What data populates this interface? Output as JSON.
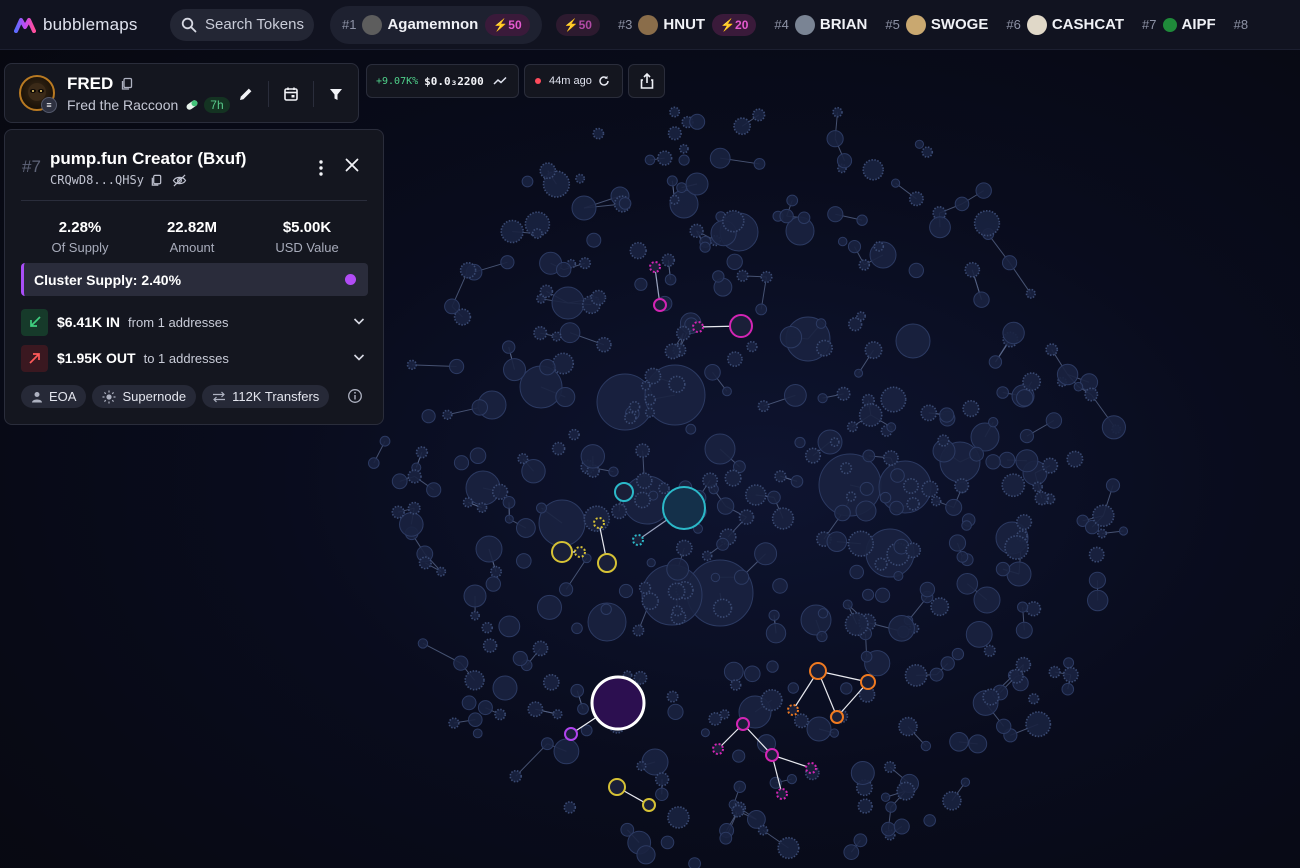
{
  "app": {
    "logo_text": "bubblemaps",
    "search_placeholder": "Search Tokens"
  },
  "ticker": [
    {
      "rank": "#1",
      "name": "Agamemnon",
      "boost": "50",
      "boost2": "50",
      "avatar": "#5d5d5d"
    },
    {
      "rank": "#3",
      "name": "HNUT",
      "boost": "20",
      "avatar": "#8a6d4a"
    },
    {
      "rank": "#4",
      "name": "BRIAN",
      "avatar": "#7a8494"
    },
    {
      "rank": "#5",
      "name": "SWOGE",
      "avatar": "#c9a870"
    },
    {
      "rank": "#6",
      "name": "CASHCAT",
      "avatar": "#e0d8c8"
    },
    {
      "rank": "#7",
      "name": "AIPF",
      "avatar": "#1f8a3a"
    },
    {
      "rank": "#8",
      "name": "",
      "avatar": ""
    }
  ],
  "token": {
    "symbol": "FRED",
    "name": "Fred the Raccoon",
    "age": "7h",
    "chain_badge": "≡"
  },
  "price": {
    "change": "+9.07K%",
    "value": "$0.0₃2200"
  },
  "refresh": {
    "label": "44m ago"
  },
  "panel": {
    "rank": "#7",
    "title": "pump.fun Creator (Bxuf)",
    "address": "CRQwD8...QHSy",
    "stats": [
      {
        "value": "2.28%",
        "label": "Of Supply"
      },
      {
        "value": "22.82M",
        "label": "Amount"
      },
      {
        "value": "$5.00K",
        "label": "USD Value"
      }
    ],
    "cluster_supply": "Cluster Supply: 2.40%",
    "in_flow": {
      "amount": "$6.41K IN",
      "desc": "from 1 addresses"
    },
    "out_flow": {
      "amount": "$1.95K OUT",
      "desc": "to 1 addresses"
    },
    "tags": [
      "EOA",
      "Supernode",
      "112K Transfers"
    ]
  },
  "colors": {
    "accent_purple": "#a94ef7",
    "in_green": "#3fcf7f",
    "out_red": "#ff5a5a",
    "node_default": "#1a2240",
    "cluster_magenta": "#d325b4",
    "cluster_cyan": "#2bb9c9",
    "cluster_yellow": "#d6c235",
    "cluster_orange": "#f07a20",
    "cluster_violet": "#b044ee"
  }
}
